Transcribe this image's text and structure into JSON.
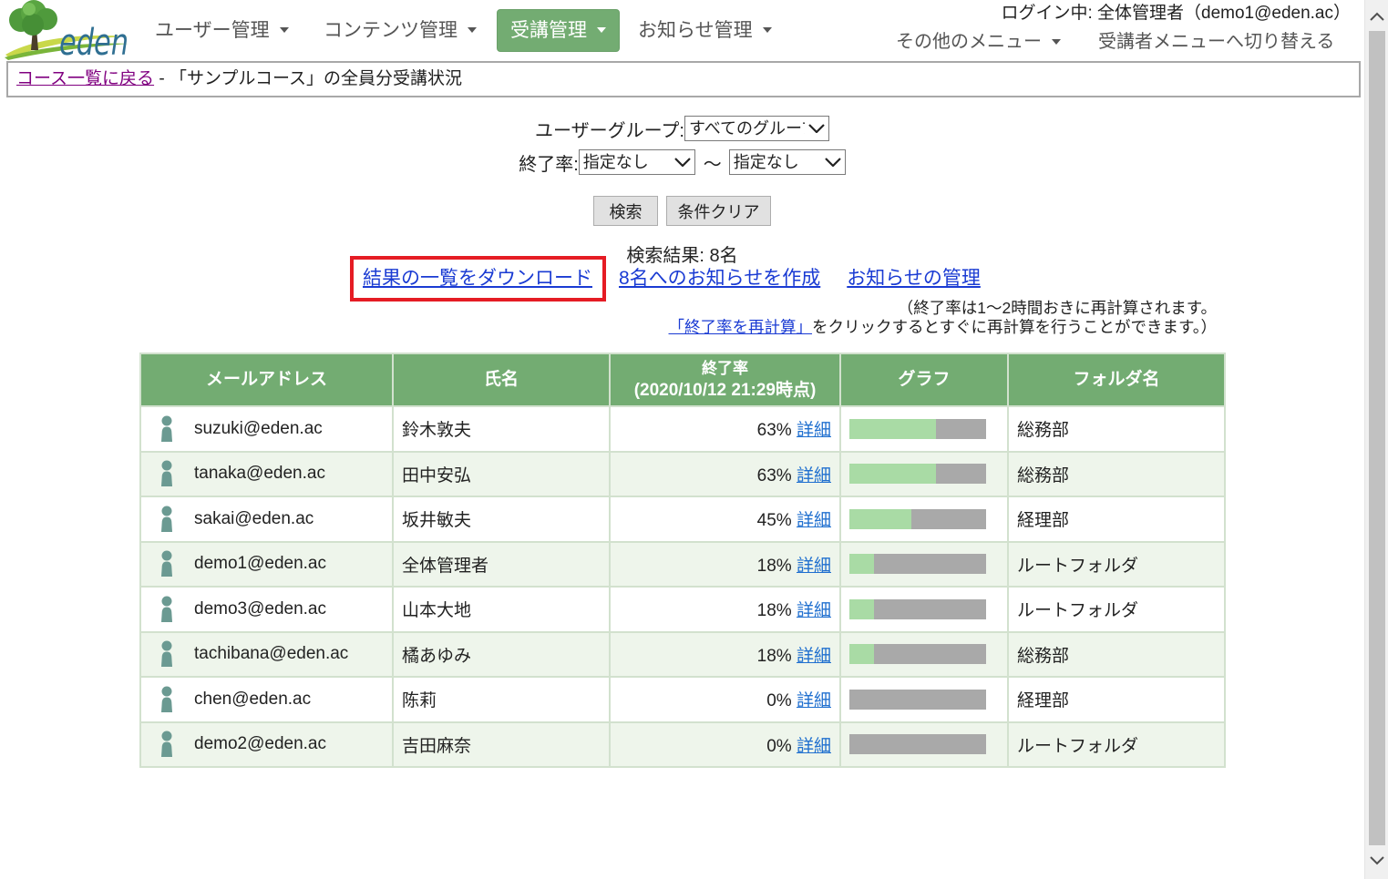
{
  "logo": {
    "text": "eden"
  },
  "nav": {
    "items": [
      {
        "label": "ユーザー管理",
        "active": false
      },
      {
        "label": "コンテンツ管理",
        "active": false
      },
      {
        "label": "受講管理",
        "active": true
      },
      {
        "label": "お知らせ管理",
        "active": false
      }
    ]
  },
  "header": {
    "login_status": "ログイン中: 全体管理者（demo1@eden.ac）",
    "other_menu": "その他のメニュー",
    "switch_link": "受講者メニューへ切り替える"
  },
  "breadcrumb": {
    "back_link": "コース一覧に戻る",
    "separator": " - ",
    "title": "「サンプルコース」の全員分受講状況"
  },
  "filters": {
    "group_label": "ユーザーグループ:",
    "group_selected": "すべてのグループ",
    "rate_label": "終了率:",
    "rate_from": "指定なし",
    "range_separator": "〜",
    "rate_to": "指定なし",
    "search_button": "検索",
    "clear_button": "条件クリア"
  },
  "results": {
    "count_text": "検索結果: 8名",
    "download_link": "結果の一覧をダウンロード",
    "create_notice_link": "8名へのお知らせを作成",
    "manage_notice_link": "お知らせの管理",
    "note_line1": "（終了率は1〜2時間おきに再計算されます。",
    "recalc_link": "「終了率を再計算」",
    "note_line2_rest": "をクリックするとすぐに再計算を行うことができます。）"
  },
  "table": {
    "headers": {
      "email": "メールアドレス",
      "name": "氏名",
      "rate": "終了率",
      "rate_timestamp": "(2020/10/12 21:29時点)",
      "graph": "グラフ",
      "folder": "フォルダ名"
    },
    "detail_label": "詳細",
    "rows": [
      {
        "email": "suzuki@eden.ac",
        "name": "鈴木敦夫",
        "rate": "63%",
        "folder": "総務部"
      },
      {
        "email": "tanaka@eden.ac",
        "name": "田中安弘",
        "rate": "63%",
        "folder": "総務部"
      },
      {
        "email": "sakai@eden.ac",
        "name": "坂井敏夫",
        "rate": "45%",
        "folder": "経理部"
      },
      {
        "email": "demo1@eden.ac",
        "name": "全体管理者",
        "rate": "18%",
        "folder": "ルートフォルダ"
      },
      {
        "email": "demo3@eden.ac",
        "name": "山本大地",
        "rate": "18%",
        "folder": "ルートフォルダ"
      },
      {
        "email": "tachibana@eden.ac",
        "name": "橘あゆみ",
        "rate": "18%",
        "folder": "総務部"
      },
      {
        "email": "chen@eden.ac",
        "name": "陈莉",
        "rate": "0%",
        "folder": "経理部"
      },
      {
        "email": "demo2@eden.ac",
        "name": "吉田麻奈",
        "rate": "0%",
        "folder": "ルートフォルダ"
      }
    ]
  },
  "icons": {
    "nav_dropdown": "caret-down-icon",
    "select_arrow": "chevron-down-icon",
    "row_user": "person-icon",
    "scroll_up": "chevron-up-icon",
    "scroll_down": "chevron-down-icon"
  },
  "colors": {
    "accent_green": "#73ac72",
    "row_alt": "#eef5eb",
    "bar_fill": "#a9dba5",
    "bar_empty": "#a9a9a9",
    "highlight_red": "#e51c24",
    "link_blue": "#1a3bd3",
    "visited_purple": "#800080",
    "detail_link_blue": "#1f6fcf",
    "user_icon": "#6b9a92"
  }
}
